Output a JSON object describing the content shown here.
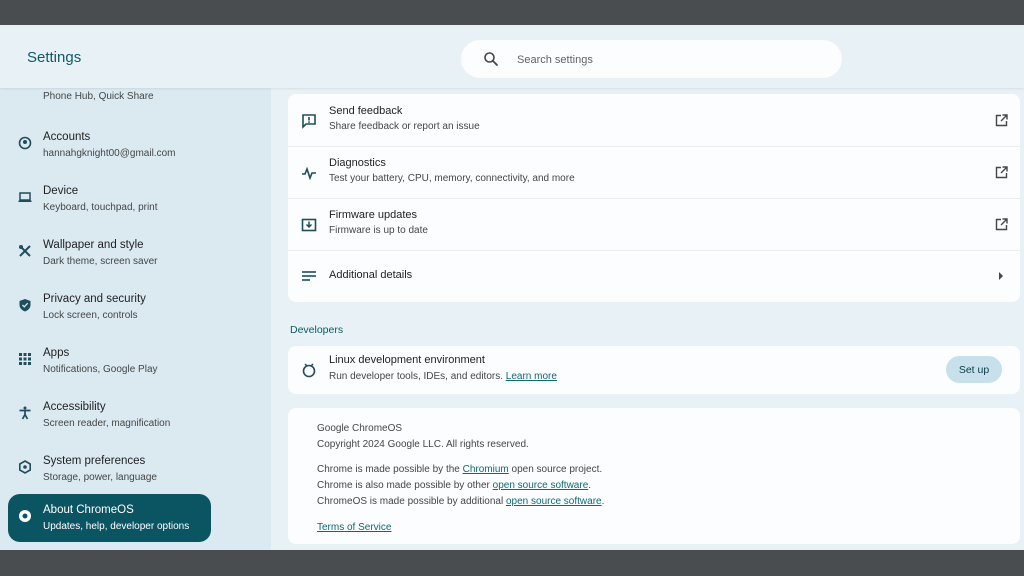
{
  "app_title": "Settings",
  "search": {
    "placeholder": "Search settings"
  },
  "sidebar": {
    "partial_item_sub": "Phone Hub, Quick Share",
    "items": [
      {
        "title": "Accounts",
        "subtitle": "hannahgknight00@gmail.com",
        "icon": "account-circle-icon"
      },
      {
        "title": "Device",
        "subtitle": "Keyboard, touchpad, print",
        "icon": "laptop-icon"
      },
      {
        "title": "Wallpaper and style",
        "subtitle": "Dark theme, screen saver",
        "icon": "palette-icon"
      },
      {
        "title": "Privacy and security",
        "subtitle": "Lock screen, controls",
        "icon": "shield-icon"
      },
      {
        "title": "Apps",
        "subtitle": "Notifications, Google Play",
        "icon": "apps-grid-icon"
      },
      {
        "title": "Accessibility",
        "subtitle": "Screen reader, magnification",
        "icon": "accessibility-icon"
      },
      {
        "title": "System preferences",
        "subtitle": "Storage, power, language",
        "icon": "settings-gear-icon"
      },
      {
        "title": "About ChromeOS",
        "subtitle": "Updates, help, developer options",
        "icon": "chrome-icon"
      }
    ]
  },
  "main": {
    "rows": [
      {
        "title": "Send feedback",
        "subtitle": "Share feedback or report an issue",
        "icon": "feedback-icon"
      },
      {
        "title": "Diagnostics",
        "subtitle": "Test your battery, CPU, memory, connectivity, and more",
        "icon": "diagnostics-icon"
      },
      {
        "title": "Firmware updates",
        "subtitle": "Firmware is up to date",
        "icon": "firmware-icon"
      },
      {
        "title": "Additional details",
        "icon": "list-icon"
      }
    ],
    "developers": {
      "section_title": "Developers",
      "linux_title": "Linux development environment",
      "linux_sub": "Run developer tools, IDEs, and editors.",
      "learn_more": "Learn more",
      "setup_label": "Set up"
    },
    "about": {
      "line1": "Google ChromeOS",
      "line2": "Copyright 2024 Google LLC. All rights reserved.",
      "line3_pre": "Chrome is made possible by the ",
      "line3_link": "Chromium",
      "line3_post": " open source project.",
      "line4_pre": "Chrome is also made possible by other ",
      "line4_link": "open source software",
      "line4_post": ".",
      "line5_pre": "ChromeOS is made possible by additional ",
      "line5_link": "open source software",
      "line5_post": ".",
      "terms": "Terms of Service"
    }
  }
}
